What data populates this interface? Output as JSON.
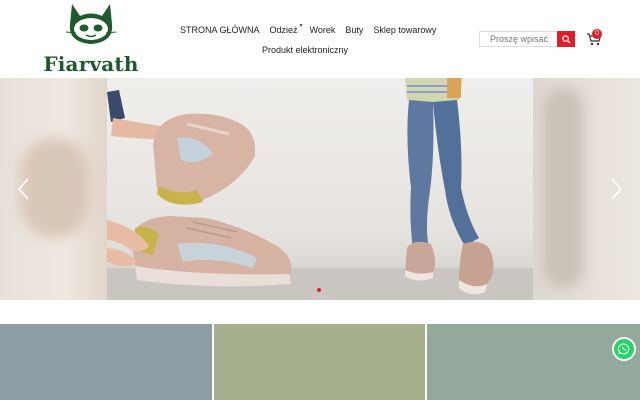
{
  "brand": {
    "name": "Fiarvath",
    "color": "#1e5b2c"
  },
  "nav": {
    "items": [
      {
        "label": "STRONA GŁÓWNA"
      },
      {
        "label": "Odzież",
        "has_dropdown": true
      },
      {
        "label": "Worek"
      },
      {
        "label": "Buty"
      },
      {
        "label": "Sklep towarowy"
      },
      {
        "label": "Produkt elektroniczny"
      }
    ]
  },
  "search": {
    "placeholder": "Proszę wpisać",
    "icon": "search-icon"
  },
  "cart": {
    "count": "0",
    "icon": "cart-icon"
  },
  "slider": {
    "prev_icon": "chevron-left-icon",
    "next_icon": "chevron-right-icon",
    "active_slide": 1
  },
  "colors": {
    "accent": "#e01e2a",
    "panel_1": "#8f9ea4",
    "panel_2": "#a6b08f",
    "panel_3": "#93a99b",
    "whatsapp": "#25d366"
  },
  "floating": {
    "icon": "whatsapp-icon"
  }
}
